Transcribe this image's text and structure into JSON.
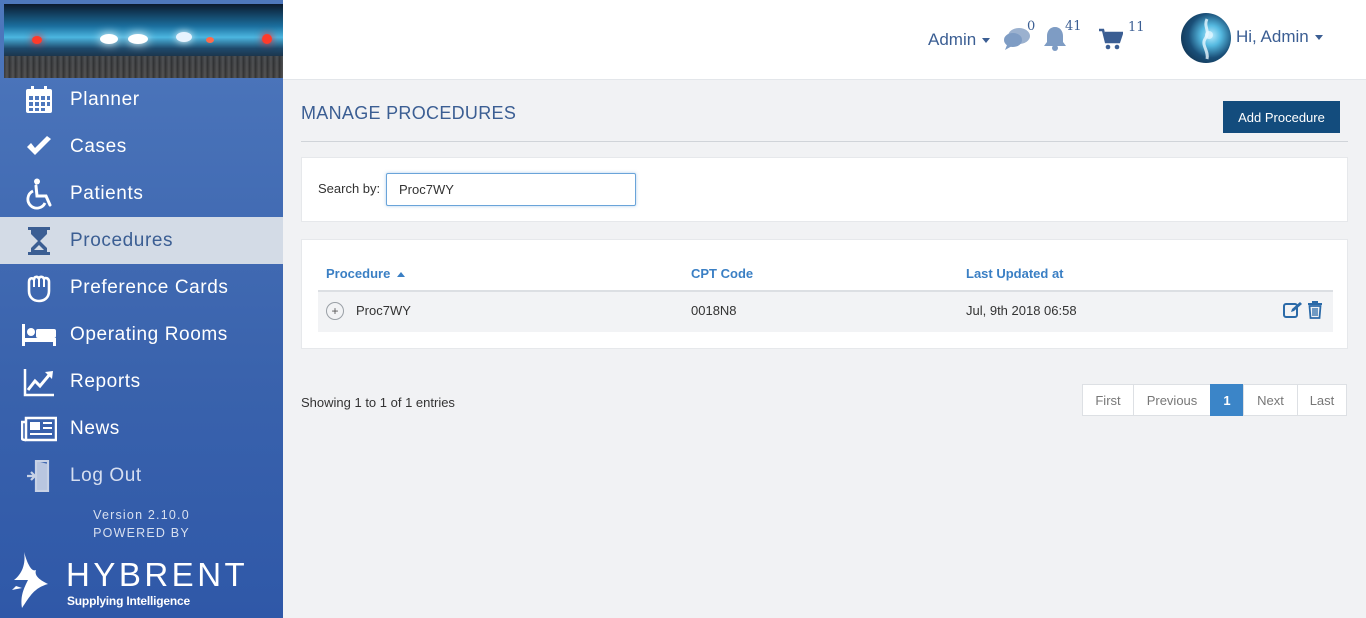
{
  "sidebar": {
    "items": [
      {
        "label": "Planner",
        "icon": "calendar-icon"
      },
      {
        "label": "Cases",
        "icon": "checkmark-icon"
      },
      {
        "label": "Patients",
        "icon": "wheelchair-icon"
      },
      {
        "label": "Procedures",
        "icon": "hourglass-icon",
        "active": true
      },
      {
        "label": "Preference Cards",
        "icon": "glove-icon"
      },
      {
        "label": "Operating Rooms",
        "icon": "bed-icon"
      },
      {
        "label": "Reports",
        "icon": "line-chart-icon"
      },
      {
        "label": "News",
        "icon": "newspaper-icon"
      },
      {
        "label": "Log Out",
        "icon": "logout-door-icon"
      }
    ],
    "version": "Version 2.10.0",
    "powered_by": "POWERED BY",
    "brand": {
      "name": "HYBRENT",
      "tagline": "Supplying Intelligence"
    }
  },
  "header": {
    "admin_menu": "Admin",
    "messages_count": "0",
    "notifications_count": "41",
    "cart_count": "11",
    "user_greeting": "Hi, Admin"
  },
  "main": {
    "title": "MANAGE PROCEDURES",
    "add_button": "Add Procedure",
    "search": {
      "label": "Search by:",
      "value": "Proc7WY"
    },
    "table": {
      "columns": [
        "Procedure",
        "CPT Code",
        "Last Updated at"
      ],
      "sort_column": "Procedure",
      "sort_direction": "ascending",
      "rows": [
        {
          "procedure": "Proc7WY",
          "cpt_code": "0018N8",
          "last_updated": "Jul, 9th 2018 06:58"
        }
      ]
    },
    "entries_text": "Showing 1 to 1 of 1 entries",
    "pagination": {
      "first": "First",
      "previous": "Previous",
      "current": "1",
      "next": "Next",
      "last": "Last"
    }
  },
  "colors": {
    "sidebar_blue": "#3a63ad",
    "accent_text": "#3b5e93",
    "link_blue": "#3a7fc4",
    "button_dark": "#134c7d",
    "active_bg": "#d3dbe6"
  }
}
